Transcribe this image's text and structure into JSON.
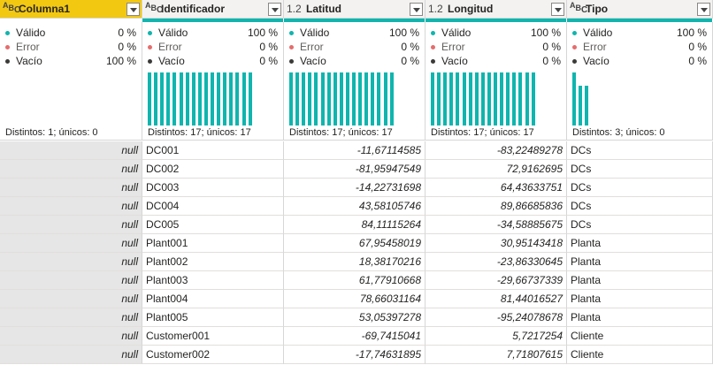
{
  "columns": [
    {
      "name": "Columna1",
      "type": "ABC",
      "selected": true,
      "valid": "0 %",
      "error": "0 %",
      "empty": "100 %",
      "distinct": "Distintos: 1; únicos: 0",
      "bars": []
    },
    {
      "name": "Identificador",
      "type": "ABC",
      "selected": false,
      "valid": "100 %",
      "error": "0 %",
      "empty": "0 %",
      "distinct": "Distintos: 17; únicos: 17",
      "bars": [
        1,
        1,
        1,
        1,
        1,
        1,
        1,
        1,
        1,
        1,
        1,
        1,
        1,
        1,
        1,
        1,
        1
      ]
    },
    {
      "name": "Latitud",
      "type": "1.2",
      "selected": false,
      "valid": "100 %",
      "error": "0 %",
      "empty": "0 %",
      "distinct": "Distintos: 17; únicos: 17",
      "bars": [
        1,
        1,
        1,
        1,
        1,
        1,
        1,
        1,
        1,
        1,
        1,
        1,
        1,
        1,
        1,
        1,
        1
      ]
    },
    {
      "name": "Longitud",
      "type": "1.2",
      "selected": false,
      "valid": "100 %",
      "error": "0 %",
      "empty": "0 %",
      "distinct": "Distintos: 17; únicos: 17",
      "bars": [
        1,
        1,
        1,
        1,
        1,
        1,
        1,
        1,
        1,
        1,
        1,
        1,
        1,
        1,
        1,
        1,
        1
      ]
    },
    {
      "name": "Tipo",
      "type": "ABC",
      "selected": false,
      "valid": "100 %",
      "error": "0 %",
      "empty": "0 %",
      "distinct": "Distintos: 3; únicos: 0",
      "bars": [
        1,
        0.75,
        0.75
      ]
    }
  ],
  "stat_labels": {
    "valid": "Válido",
    "error": "Error",
    "empty": "Vacío"
  },
  "colors": {
    "valid": "#0fb5ae",
    "error": "#e66c6c",
    "empty": "#3b3a39",
    "selected_header": "#f2c811"
  },
  "rows": [
    [
      "null",
      "DC001",
      "-11,67114585",
      "-83,22489278",
      "DCs"
    ],
    [
      "null",
      "DC002",
      "-81,95947549",
      "72,9162695",
      "DCs"
    ],
    [
      "null",
      "DC003",
      "-14,22731698",
      "64,43633751",
      "DCs"
    ],
    [
      "null",
      "DC004",
      "43,58105746",
      "89,86685836",
      "DCs"
    ],
    [
      "null",
      "DC005",
      "84,11115264",
      "-34,58885675",
      "DCs"
    ],
    [
      "null",
      "Plant001",
      "67,95458019",
      "30,95143418",
      "Planta"
    ],
    [
      "null",
      "Plant002",
      "18,38170216",
      "-23,86330645",
      "Planta"
    ],
    [
      "null",
      "Plant003",
      "61,77910668",
      "-29,66737339",
      "Planta"
    ],
    [
      "null",
      "Plant004",
      "78,66031164",
      "81,44016527",
      "Planta"
    ],
    [
      "null",
      "Plant005",
      "53,05397278",
      "-95,24078678",
      "Planta"
    ],
    [
      "null",
      "Customer001",
      "-69,7415041",
      "5,7217254",
      "Cliente"
    ],
    [
      "null",
      "Customer002",
      "-17,74631895",
      "7,71807615",
      "Cliente"
    ]
  ]
}
